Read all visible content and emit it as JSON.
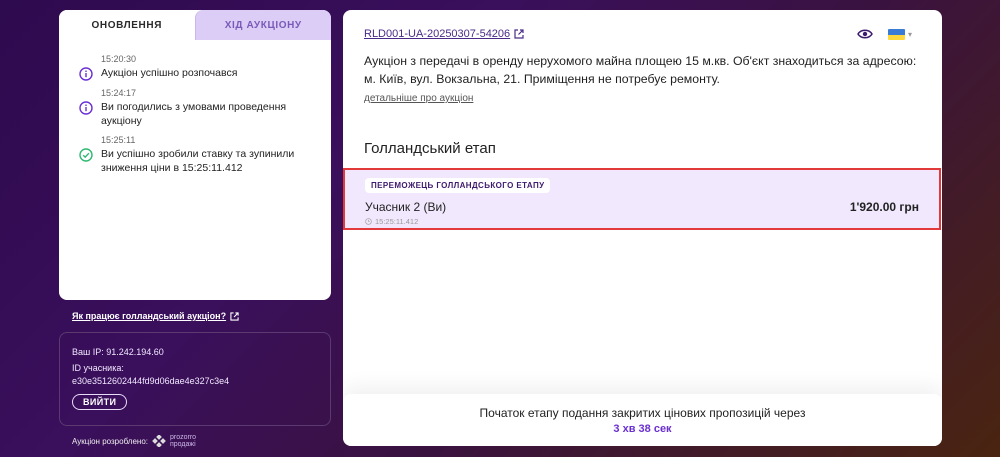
{
  "tabs": {
    "updates": "ОНОВЛЕННЯ",
    "progress": "ХІД АУКЦІОНУ"
  },
  "updates": [
    {
      "time": "15:20:30",
      "message": "Аукціон успішно розпочався",
      "icon": "info-icon"
    },
    {
      "time": "15:24:17",
      "message": "Ви погодились з умовами проведення аукціону",
      "icon": "info-icon"
    },
    {
      "time": "15:25:11",
      "message": "Ви успішно зробили ставку та зупинили зниження ціни в 15:25:11.412",
      "icon": "check-circle-icon"
    }
  ],
  "how_link": "Як працює голландський аукціон?",
  "user_info": {
    "ip": "Ваш IP: 91.242.194.60",
    "participant_id_label": "ID учасника:",
    "participant_id": "e30e3512602444fd9d06dae4e327c3e4",
    "logout": "ВИЙТИ"
  },
  "made_by": {
    "label": "Аукціон розроблено:",
    "logo_line1": "prozorro",
    "logo_line2": "продажі"
  },
  "auction": {
    "id": "RLD001-UA-20250307-54206",
    "description": "Аукціон з передачі в оренду нерухомого майна площею 15 м.кв. Об'єкт знаходиться за адресою: м. Київ, вул. Вокзальна, 21. Приміщення не потребує ремонту.",
    "more_link": "детальніше про аукціон",
    "stage_title": "Голландський етап"
  },
  "winner": {
    "badge": "ПЕРЕМОЖЕЦЬ ГОЛЛАНДСЬКОГО ЕТАПУ",
    "name": "Учасник 2 (Ви)",
    "price": "1'920.00 грн",
    "time": "15:25:11.412"
  },
  "footer": {
    "text": "Початок етапу подання закритих цінових пропозицій через",
    "countdown": "3 хв 38 сек"
  },
  "colors": {
    "accent": "#6a2fd1",
    "winner_bg": "#f1e8fd",
    "highlight_border": "#e23a3a"
  }
}
